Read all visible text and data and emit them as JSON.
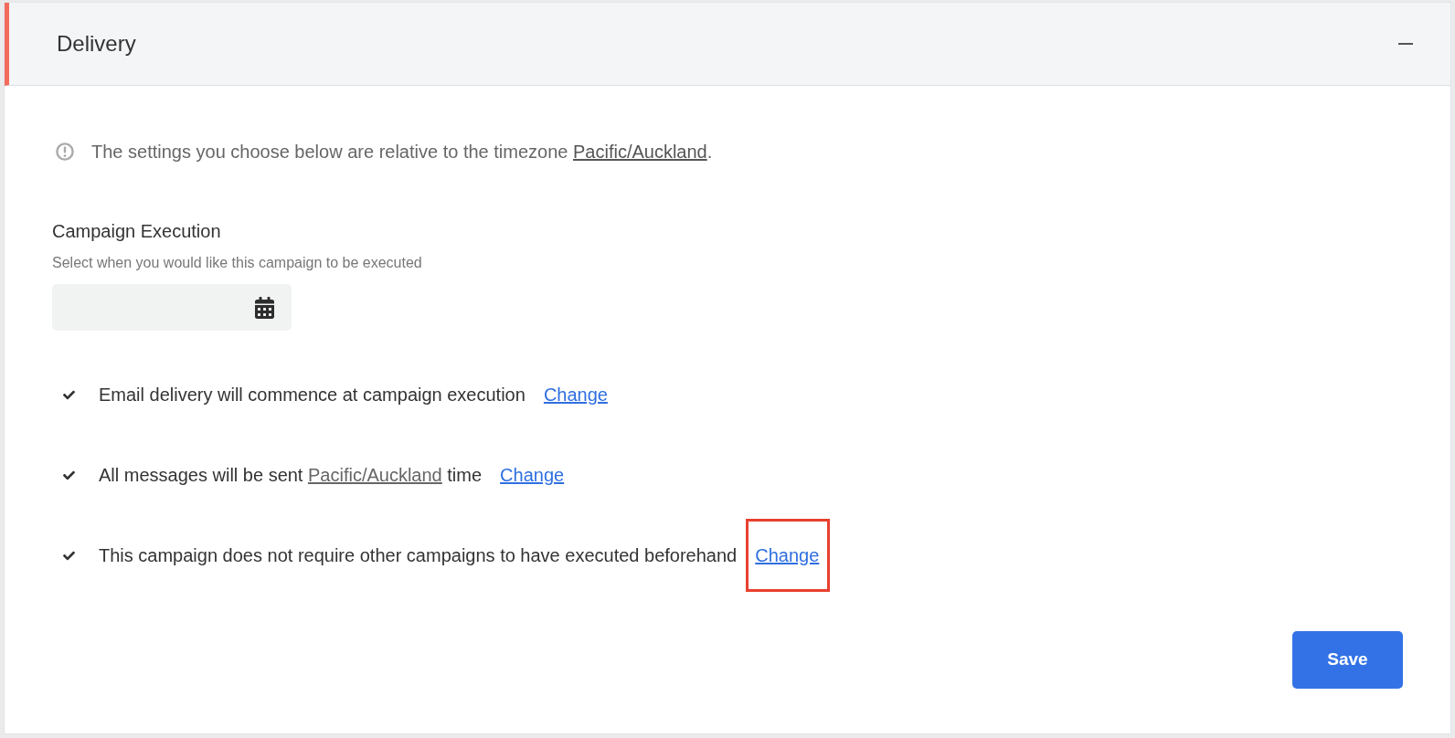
{
  "panel": {
    "title": "Delivery",
    "expanded": true
  },
  "notice": {
    "text": "The settings you choose below are relative to the timezone",
    "link": "Pacific/Auckland",
    "after": "."
  },
  "execution": {
    "label": "Campaign Execution",
    "hint": "Select when you would like this campaign to be executed"
  },
  "rules": [
    {
      "text": "Email delivery will commence at campaign execution",
      "action": "Change",
      "highlighted": false
    },
    {
      "text": "All messages will be sent",
      "link": "Pacific/Auckland",
      "after": "time",
      "action": "Change",
      "highlighted": false
    },
    {
      "text": "This campaign does not require other campaigns to have executed beforehand",
      "action": "Change",
      "highlighted": true
    }
  ],
  "save_button": "Save"
}
